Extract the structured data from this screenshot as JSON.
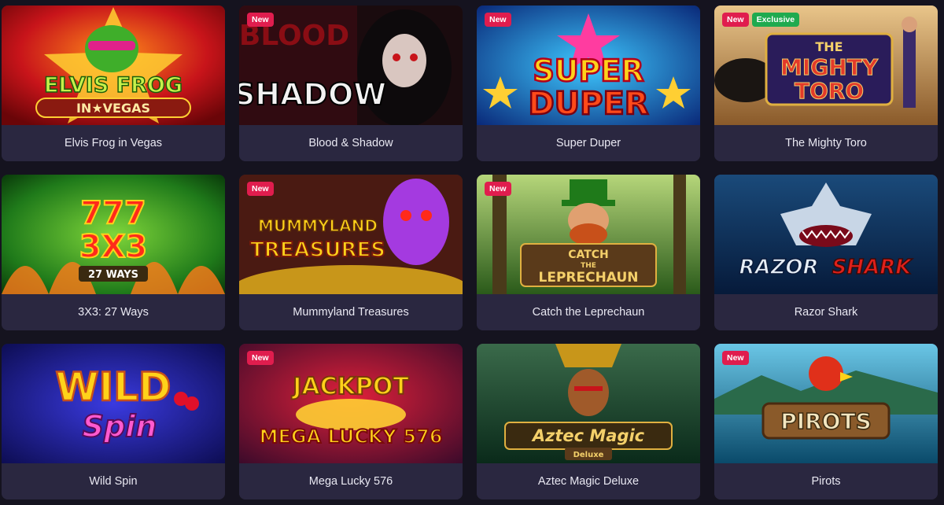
{
  "badges": {
    "new": "New",
    "exclusive": "Exclusive"
  },
  "colors": {
    "caption_bg": "#2a2740",
    "page_bg": "#15131f",
    "new_badge": "#e01d4e",
    "exclusive_badge": "#1faa4f"
  },
  "games": [
    {
      "title": "Elvis Frog in Vegas",
      "art": {
        "line1": "ELVIS FROG",
        "line2": "IN★VEGAS"
      }
    },
    {
      "title": "Blood & Shadow",
      "art": {
        "line1": "BLOOD",
        "line2": "SHADOW"
      }
    },
    {
      "title": "Super Duper",
      "art": {
        "line1": "SUPER",
        "line2": "DUPER"
      }
    },
    {
      "title": "The Mighty Toro",
      "art": {
        "line1": "THE",
        "line2": "MIGHTY",
        "line3": "TORO"
      }
    },
    {
      "title": "3X3: 27 Ways",
      "art": {
        "line1": "777",
        "line2": "3X3",
        "line3": "27 WAYS"
      }
    },
    {
      "title": "Mummyland Treasures",
      "art": {
        "line1": "MUMMYLAND",
        "line2": "TREASURES"
      }
    },
    {
      "title": "Catch the Leprechaun",
      "art": {
        "line1": "CATCH",
        "line2": "THE",
        "line3": "LEPRECHAUN"
      }
    },
    {
      "title": "Razor Shark",
      "art": {
        "line1": "RAZOR",
        "line2": "SHARK"
      }
    },
    {
      "title": "Wild Spin",
      "art": {
        "line1": "WILD",
        "line2": "Spin"
      }
    },
    {
      "title": "Mega Lucky 576",
      "art": {
        "line1": "JACKPOT",
        "line2": "MEGA LUCKY 576"
      }
    },
    {
      "title": "Aztec Magic Deluxe",
      "art": {
        "line1": "Aztec Magic",
        "line2": "Deluxe"
      }
    },
    {
      "title": "Pirots",
      "art": {
        "line1": "PIROTS"
      }
    }
  ]
}
